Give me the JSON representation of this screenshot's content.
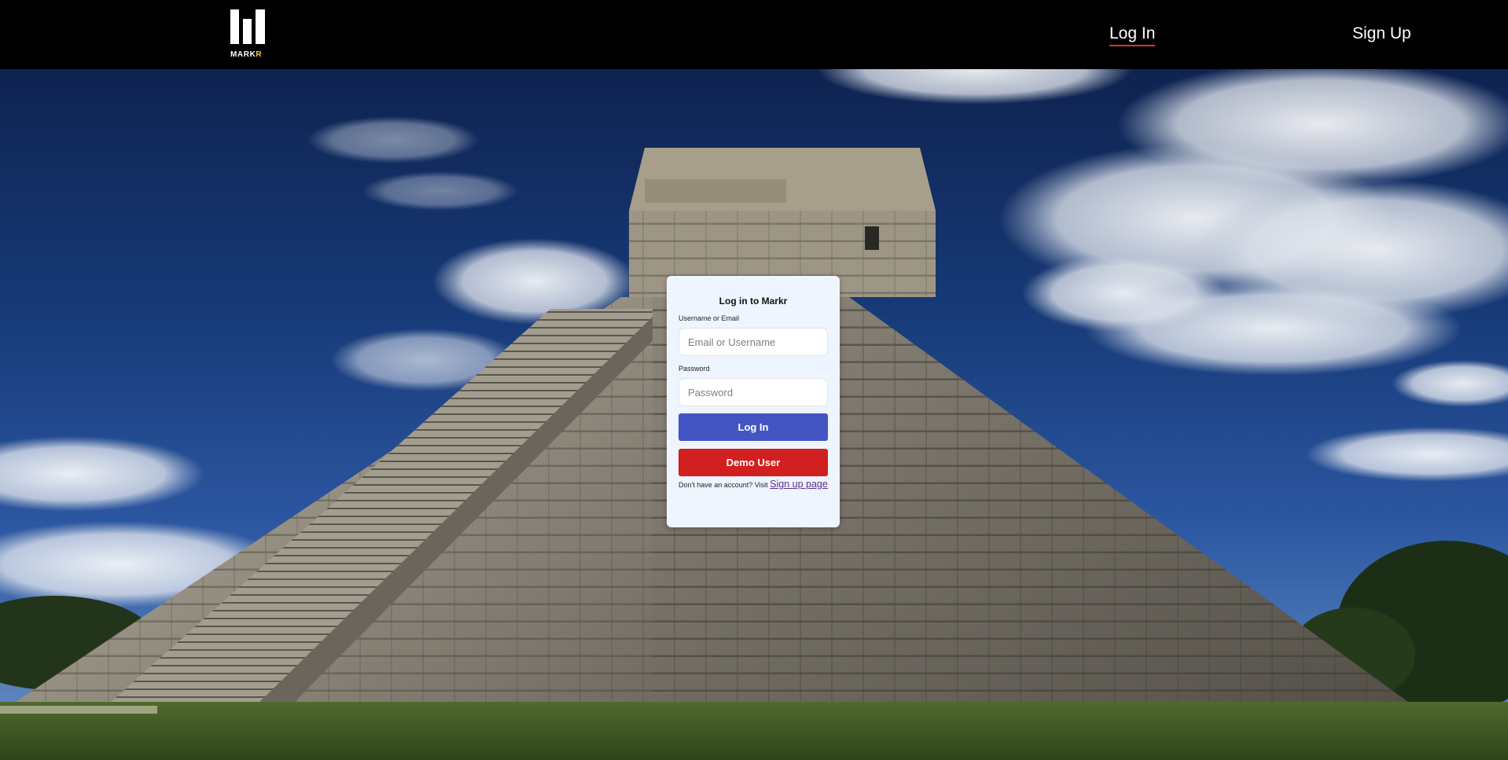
{
  "brand": {
    "name_main": "MARK",
    "name_accent": "R",
    "accent_color": "#f2c94c",
    "icon": "markr-bars-logo"
  },
  "nav": {
    "login_label": "Log In",
    "signup_label": "Sign Up",
    "active_underline_color": "#d9342b"
  },
  "background": {
    "description_icon": "pyramid-photo"
  },
  "login_card": {
    "title": "Log in to Markr",
    "username_label": "Username or Email",
    "username_placeholder": "Email or Username",
    "password_label": "Password",
    "password_placeholder": "Password",
    "login_button": "Log In",
    "demo_button": "Demo User",
    "signup_prompt": "Don't have an account? Visit",
    "signup_link": "Sign up page",
    "colors": {
      "login_button": "#4355c2",
      "demo_button": "#d21f1f",
      "card_background": "#eef5fe"
    }
  }
}
